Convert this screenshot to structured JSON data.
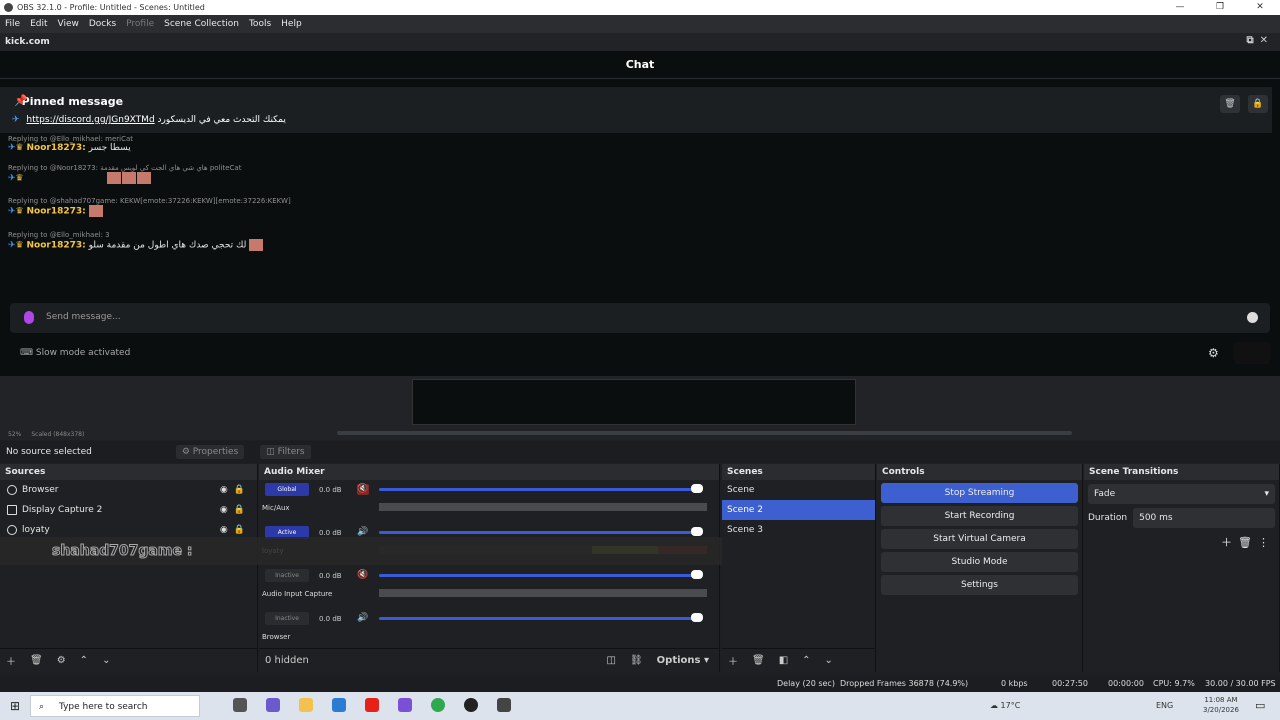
{
  "window": {
    "title": "OBS 32.1.0 - Profile: Untitled - Scenes: Untitled",
    "controls": [
      "—",
      "❐",
      "✕"
    ]
  },
  "menu": [
    "File",
    "Edit",
    "View",
    "Docks",
    "Profile",
    "Scene Collection",
    "Tools",
    "Help"
  ],
  "dock": {
    "title": "kick.com"
  },
  "chat": {
    "header": "Chat",
    "pinned": {
      "label": "Pinned message",
      "link": "https://discord.gg/JGn9XTMd",
      "text": "يمكنك التحدث معي في الديسكورد"
    },
    "messages": [
      {
        "reply": "Replying to @Ello_mikhael: meriCat",
        "user": "Noor18273:",
        "text": "يسطا جسر"
      },
      {
        "reply": "Replying to @Noor18273: هاي شي هاي الجت كي لويس مقدمة politeCat",
        "user": "",
        "text": ""
      },
      {
        "reply": "Replying to @shahad707game: KEKW[emote:37226:KEKW][emote:37226:KEKW]",
        "user": "Noor18273:",
        "text": ""
      },
      {
        "reply": "Replying to @Ello_mikhael: 3",
        "user": "Noor18273:",
        "text": "لك تحجي صدك هاي اطول من مقدمة سلو"
      }
    ],
    "composer_placeholder": "Send message...",
    "slow_mode": "Slow mode activated"
  },
  "preview": {
    "zoom": "52%",
    "scale": "Scaled (848x378)"
  },
  "source_bar": {
    "status": "No source selected",
    "properties": "Properties",
    "filters": "Filters"
  },
  "sources": {
    "title": "Sources",
    "items": [
      "Browser",
      "Display Capture 2",
      "loyaty"
    ]
  },
  "overlay_text": "shahad707game :",
  "mixer": {
    "title": "Audio Mixer",
    "channels": [
      {
        "chip": "Global",
        "db": "0.0 dB",
        "name": "Mic/Aux",
        "level": 0.2
      },
      {
        "chip": "Active",
        "db": "0.0 dB",
        "name": "loyaty",
        "level": 0.0
      },
      {
        "chip": "Inactive",
        "db": "0.0 dB",
        "name": "Audio Input Capture",
        "level": 0.2
      },
      {
        "chip": "Inactive",
        "db": "0.0 dB",
        "name": "Browser",
        "level": 0.0
      }
    ],
    "hidden": "0 hidden",
    "options": "Options"
  },
  "scenes": {
    "title": "Scenes",
    "items": [
      "Scene",
      "Scene 2",
      "Scene 3"
    ],
    "selected": "Scene 2"
  },
  "controls": {
    "title": "Controls",
    "buttons": [
      "Stop Streaming",
      "Start Recording",
      "Start Virtual Camera",
      "Studio Mode",
      "Settings"
    ]
  },
  "transitions": {
    "title": "Scene Transitions",
    "type": "Fade",
    "duration_label": "Duration",
    "duration": "500 ms"
  },
  "status": {
    "delay": "Delay (20 sec)",
    "dropped": "Dropped Frames 36878 (74.9%)",
    "kbps": "0 kbps",
    "stream_time": "00:27:50",
    "rec_time": "00:00:00",
    "cpu": "CPU: 9.7%",
    "fps": "30.00 / 30.00 FPS"
  },
  "taskbar": {
    "search": "Type here to search",
    "weather": "17°C",
    "lang": "ENG",
    "time": "11:08 AM",
    "date": "3/20/2026"
  },
  "colors": {
    "accent": "#3e5fd0",
    "kick_green": "#53fc18",
    "username": "#f5c542"
  }
}
